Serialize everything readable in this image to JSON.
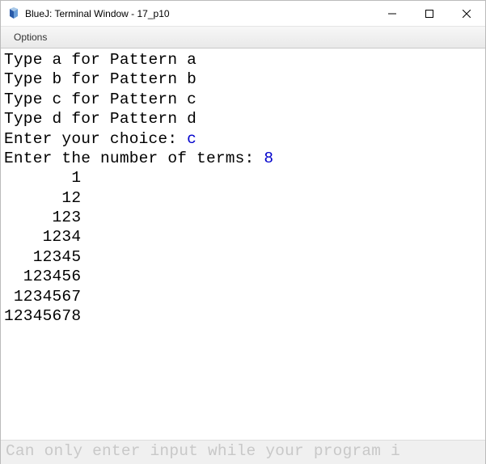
{
  "titlebar": {
    "title": "BlueJ: Terminal Window - 17_p10"
  },
  "menubar": {
    "options": "Options"
  },
  "terminal": {
    "lines": [
      {
        "text": "Type a for Pattern a",
        "input": null
      },
      {
        "text": "Type b for Pattern b",
        "input": null
      },
      {
        "text": "Type c for Pattern c",
        "input": null
      },
      {
        "text": "Type d for Pattern d",
        "input": null
      },
      {
        "text": "Enter your choice: ",
        "input": "c"
      },
      {
        "text": "Enter the number of terms: ",
        "input": "8"
      },
      {
        "text": "       1",
        "input": null
      },
      {
        "text": "      12",
        "input": null
      },
      {
        "text": "     123",
        "input": null
      },
      {
        "text": "    1234",
        "input": null
      },
      {
        "text": "   12345",
        "input": null
      },
      {
        "text": "  123456",
        "input": null
      },
      {
        "text": " 1234567",
        "input": null
      },
      {
        "text": "12345678",
        "input": null
      }
    ]
  },
  "inputbar": {
    "placeholder": "Can only enter input while your program i"
  }
}
